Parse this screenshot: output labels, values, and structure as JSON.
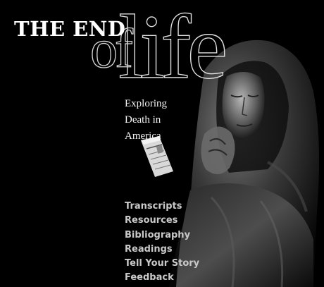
{
  "title": {
    "line1": "THE END",
    "of": "of",
    "life": "life"
  },
  "subtitle": {
    "line1": "Exploring",
    "line2": "Death in",
    "line3": "America"
  },
  "nav": {
    "items": [
      {
        "label": "Transcripts"
      },
      {
        "label": "Resources"
      },
      {
        "label": "Bibliography"
      },
      {
        "label": "Readings"
      },
      {
        "label": "Tell Your Story"
      },
      {
        "label": "Feedback"
      }
    ]
  },
  "images": {
    "statue": "hooded-mourning-statue",
    "newspaper": "folded-newspaper"
  },
  "colors": {
    "background": "#000000",
    "title": "#ffffff",
    "nav_text": "#c9c9c9"
  }
}
